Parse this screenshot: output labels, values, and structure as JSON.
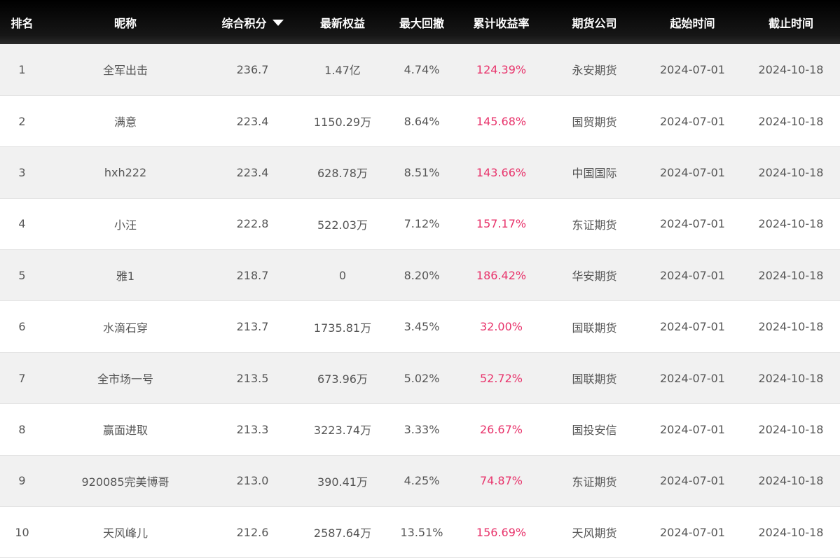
{
  "table": {
    "headers": {
      "rank": "排名",
      "nickname": "昵称",
      "score": "综合积分",
      "equity": "最新权益",
      "drawdown": "最大回撤",
      "return": "累计收益率",
      "company": "期货公司",
      "start": "起始时间",
      "end": "截止时间"
    },
    "sorted_by": "score",
    "sort_direction": "desc",
    "return_color": "#e8336b",
    "rows": [
      {
        "rank": "1",
        "nickname": "全军出击",
        "score": "236.7",
        "equity": "1.47亿",
        "drawdown": "4.74%",
        "return": "124.39%",
        "company": "永安期货",
        "start": "2024-07-01",
        "end": "2024-10-18"
      },
      {
        "rank": "2",
        "nickname": "满意",
        "score": "223.4",
        "equity": "1150.29万",
        "drawdown": "8.64%",
        "return": "145.68%",
        "company": "国贸期货",
        "start": "2024-07-01",
        "end": "2024-10-18"
      },
      {
        "rank": "3",
        "nickname": "hxh222",
        "score": "223.4",
        "equity": "628.78万",
        "drawdown": "8.51%",
        "return": "143.66%",
        "company": "中国国际",
        "start": "2024-07-01",
        "end": "2024-10-18"
      },
      {
        "rank": "4",
        "nickname": "小汪",
        "score": "222.8",
        "equity": "522.03万",
        "drawdown": "7.12%",
        "return": "157.17%",
        "company": "东证期货",
        "start": "2024-07-01",
        "end": "2024-10-18"
      },
      {
        "rank": "5",
        "nickname": "雅1",
        "score": "218.7",
        "equity": "0",
        "drawdown": "8.20%",
        "return": "186.42%",
        "company": "华安期货",
        "start": "2024-07-01",
        "end": "2024-10-18"
      },
      {
        "rank": "6",
        "nickname": "水滴石穿",
        "score": "213.7",
        "equity": "1735.81万",
        "drawdown": "3.45%",
        "return": "32.00%",
        "company": "国联期货",
        "start": "2024-07-01",
        "end": "2024-10-18"
      },
      {
        "rank": "7",
        "nickname": "全市场一号",
        "score": "213.5",
        "equity": "673.96万",
        "drawdown": "5.02%",
        "return": "52.72%",
        "company": "国联期货",
        "start": "2024-07-01",
        "end": "2024-10-18"
      },
      {
        "rank": "8",
        "nickname": "赢面进取",
        "score": "213.3",
        "equity": "3223.74万",
        "drawdown": "3.33%",
        "return": "26.67%",
        "company": "国投安信",
        "start": "2024-07-01",
        "end": "2024-10-18"
      },
      {
        "rank": "9",
        "nickname": "920085完美博哥",
        "score": "213.0",
        "equity": "390.41万",
        "drawdown": "4.25%",
        "return": "74.87%",
        "company": "东证期货",
        "start": "2024-07-01",
        "end": "2024-10-18"
      },
      {
        "rank": "10",
        "nickname": "天风峰儿",
        "score": "212.6",
        "equity": "2587.64万",
        "drawdown": "13.51%",
        "return": "156.69%",
        "company": "天风期货",
        "start": "2024-07-01",
        "end": "2024-10-18"
      }
    ]
  }
}
